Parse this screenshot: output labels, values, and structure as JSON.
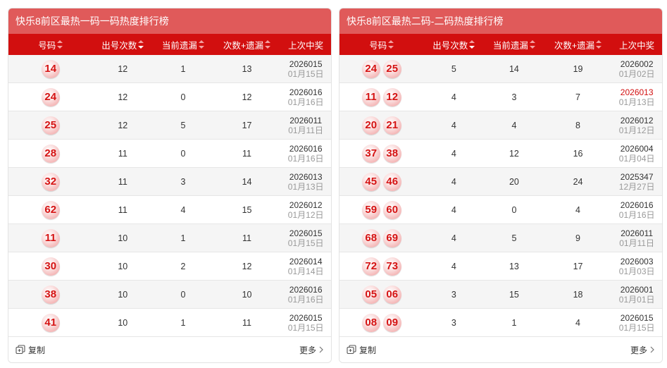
{
  "left": {
    "title": "快乐8前区最热一码一码热度排行榜",
    "headers": [
      "号码",
      "出号次数",
      "当前遗漏",
      "次数+遗漏",
      "上次中奖"
    ],
    "rows": [
      {
        "balls": [
          "14"
        ],
        "count": "12",
        "miss": "1",
        "sum": "13",
        "period": "2026015",
        "md": "01月15日"
      },
      {
        "balls": [
          "24"
        ],
        "count": "12",
        "miss": "0",
        "sum": "12",
        "period": "2026016",
        "md": "01月16日"
      },
      {
        "balls": [
          "25"
        ],
        "count": "12",
        "miss": "5",
        "sum": "17",
        "period": "2026011",
        "md": "01月11日"
      },
      {
        "balls": [
          "28"
        ],
        "count": "11",
        "miss": "0",
        "sum": "11",
        "period": "2026016",
        "md": "01月16日"
      },
      {
        "balls": [
          "32"
        ],
        "count": "11",
        "miss": "3",
        "sum": "14",
        "period": "2026013",
        "md": "01月13日"
      },
      {
        "balls": [
          "62"
        ],
        "count": "11",
        "miss": "4",
        "sum": "15",
        "period": "2026012",
        "md": "01月12日"
      },
      {
        "balls": [
          "11"
        ],
        "count": "10",
        "miss": "1",
        "sum": "11",
        "period": "2026015",
        "md": "01月15日"
      },
      {
        "balls": [
          "30"
        ],
        "count": "10",
        "miss": "2",
        "sum": "12",
        "period": "2026014",
        "md": "01月14日"
      },
      {
        "balls": [
          "38"
        ],
        "count": "10",
        "miss": "0",
        "sum": "10",
        "period": "2026016",
        "md": "01月16日"
      },
      {
        "balls": [
          "41"
        ],
        "count": "10",
        "miss": "1",
        "sum": "11",
        "period": "2026015",
        "md": "01月15日"
      }
    ],
    "copy_label": "复制",
    "more_label": "更多"
  },
  "right": {
    "title": "快乐8前区最热二码-二码热度排行榜",
    "headers": [
      "号码",
      "出号次数",
      "当前遗漏",
      "次数+遗漏",
      "上次中奖"
    ],
    "rows": [
      {
        "balls": [
          "24",
          "25"
        ],
        "count": "5",
        "miss": "14",
        "sum": "19",
        "period": "2026002",
        "md": "01月02日"
      },
      {
        "balls": [
          "11",
          "12"
        ],
        "count": "4",
        "miss": "3",
        "sum": "7",
        "period": "2026013",
        "md": "01月13日",
        "highlight": true
      },
      {
        "balls": [
          "20",
          "21"
        ],
        "count": "4",
        "miss": "4",
        "sum": "8",
        "period": "2026012",
        "md": "01月12日"
      },
      {
        "balls": [
          "37",
          "38"
        ],
        "count": "4",
        "miss": "12",
        "sum": "16",
        "period": "2026004",
        "md": "01月04日"
      },
      {
        "balls": [
          "45",
          "46"
        ],
        "count": "4",
        "miss": "20",
        "sum": "24",
        "period": "2025347",
        "md": "12月27日"
      },
      {
        "balls": [
          "59",
          "60"
        ],
        "count": "4",
        "miss": "0",
        "sum": "4",
        "period": "2026016",
        "md": "01月16日"
      },
      {
        "balls": [
          "68",
          "69"
        ],
        "count": "4",
        "miss": "5",
        "sum": "9",
        "period": "2026011",
        "md": "01月11日"
      },
      {
        "balls": [
          "72",
          "73"
        ],
        "count": "4",
        "miss": "13",
        "sum": "17",
        "period": "2026003",
        "md": "01月03日"
      },
      {
        "balls": [
          "05",
          "06"
        ],
        "count": "3",
        "miss": "15",
        "sum": "18",
        "period": "2026001",
        "md": "01月01日"
      },
      {
        "balls": [
          "08",
          "09"
        ],
        "count": "3",
        "miss": "1",
        "sum": "4",
        "period": "2026015",
        "md": "01月15日"
      }
    ],
    "copy_label": "复制",
    "more_label": "更多"
  },
  "colors": {
    "header_red": "#d20f0f",
    "title_red": "#e05a5a",
    "ball_text": "#d51313",
    "highlight": "#d20f0f"
  },
  "icons": {
    "copy": "copy-icon",
    "more": "chevron-right-icon",
    "sort": "sort-icon"
  }
}
